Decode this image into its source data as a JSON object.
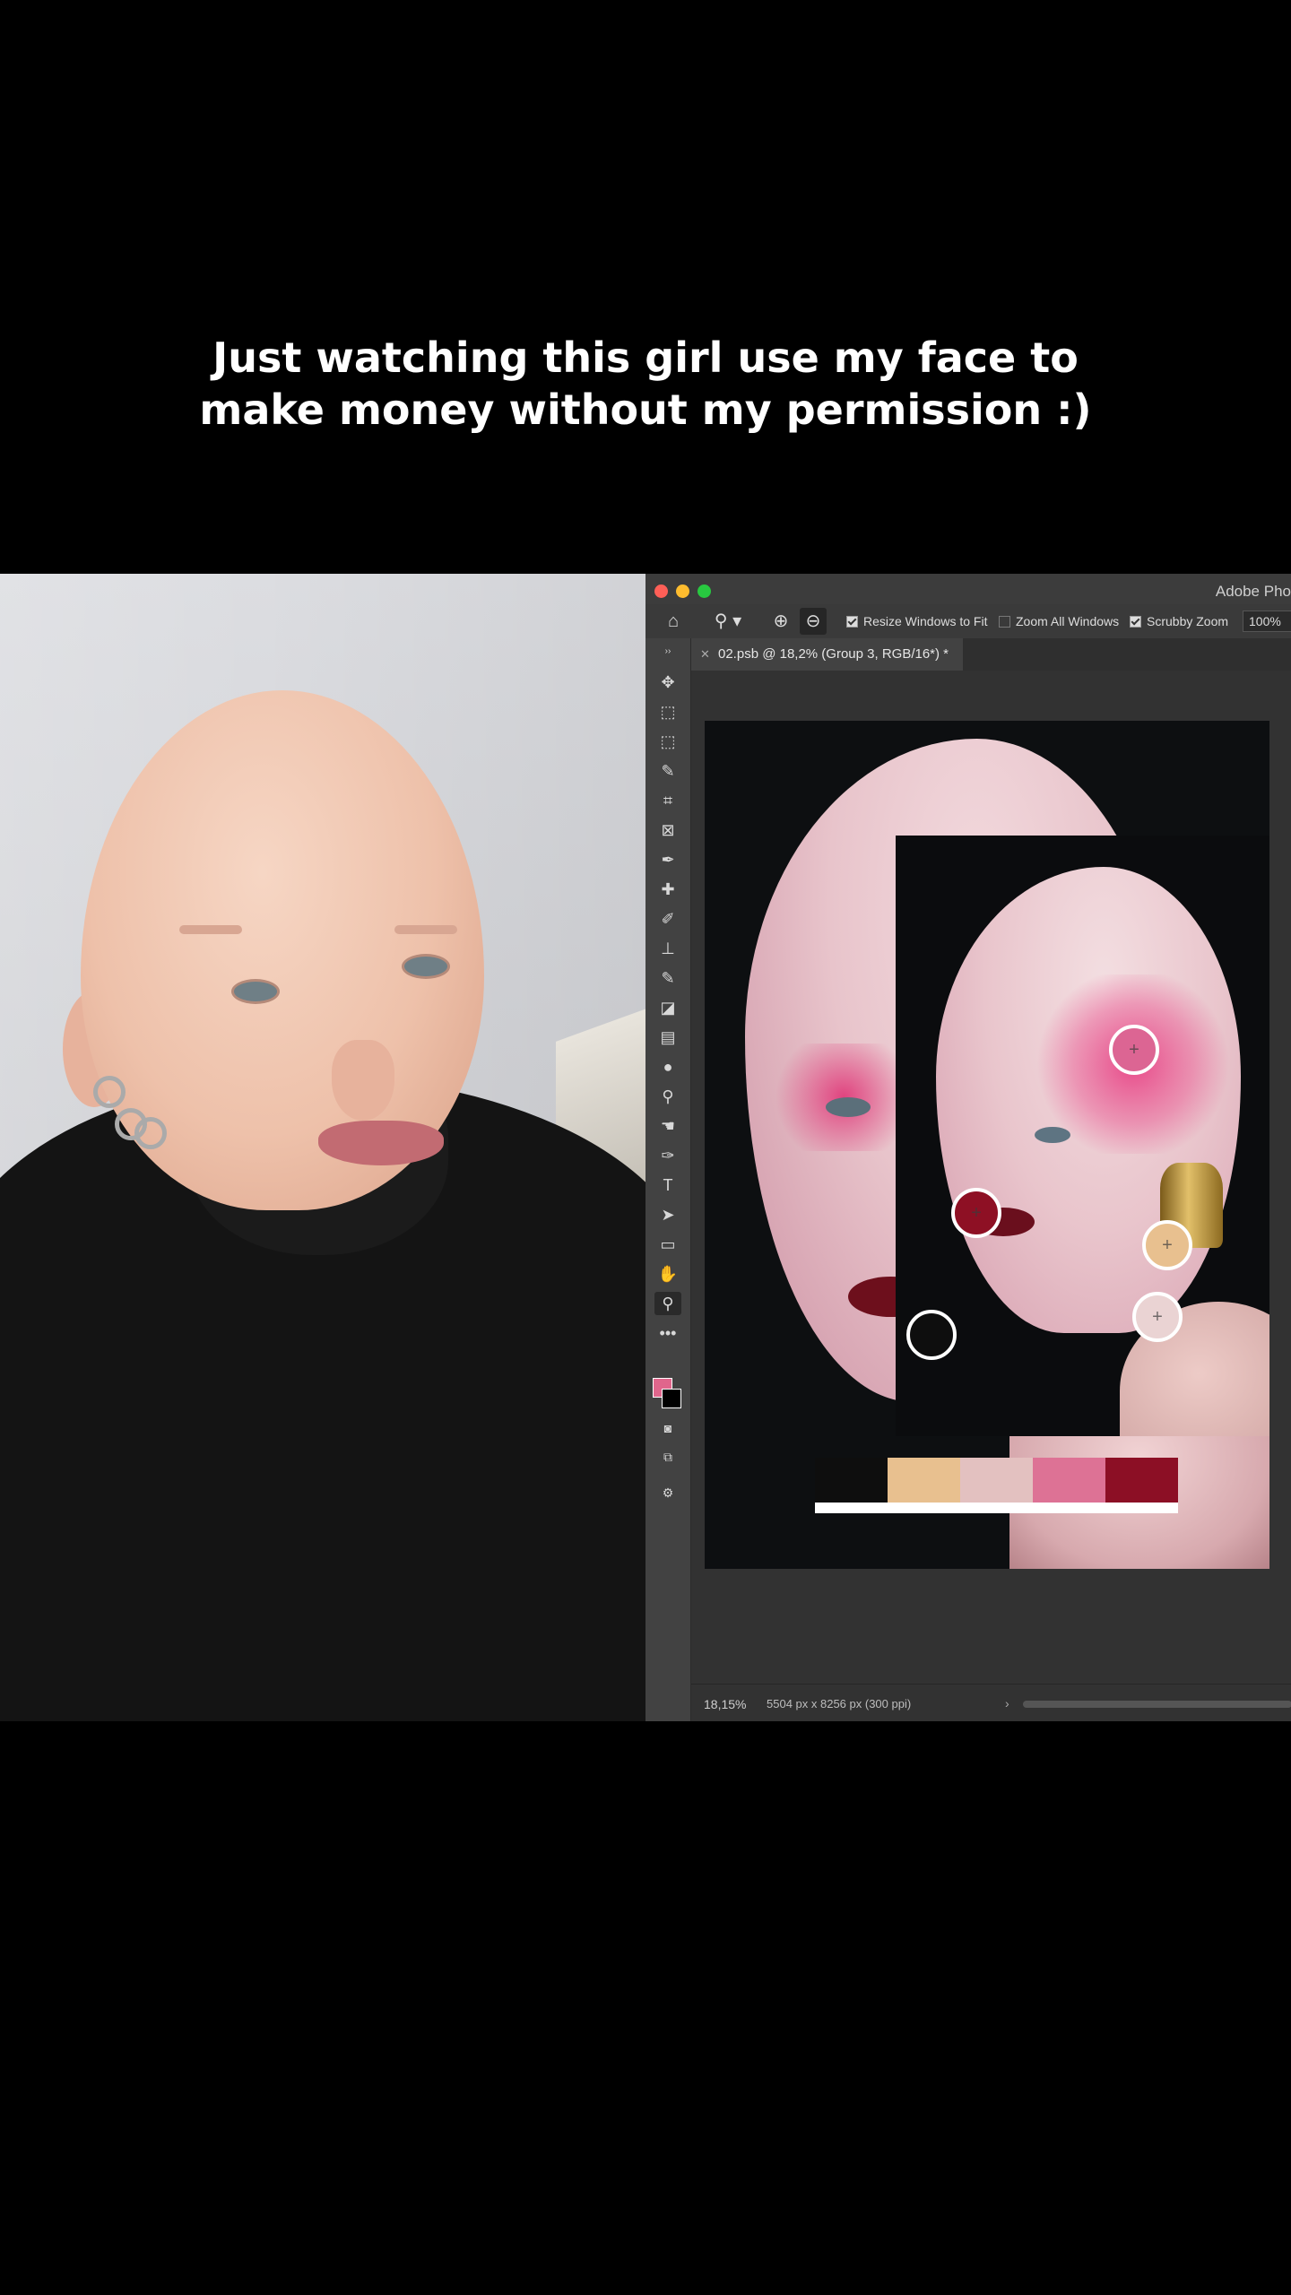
{
  "caption": {
    "line1": "Just watching this girl use my face to",
    "line2": "make money without my permission :)"
  },
  "photoshop": {
    "app_title": "Adobe Pho",
    "options": {
      "resize_windows": "Resize Windows to Fit",
      "resize_windows_checked": true,
      "zoom_all_windows": "Zoom All Windows",
      "zoom_all_windows_checked": false,
      "scrubby_zoom": "Scrubby Zoom",
      "scrubby_zoom_checked": true,
      "zoom_value": "100%"
    },
    "document_tab": "02.psb @ 18,2% (Group 3, RGB/16*) *",
    "status": {
      "zoom": "18,15%",
      "doc_size": "5504 px x 8256 px (300 ppi)"
    },
    "foreground_color": "#e0668c",
    "background_color": "#000000",
    "palette": [
      {
        "color": "#0e0e0e"
      },
      {
        "color": "#e8c08f"
      },
      {
        "color": "#e3c1c0"
      },
      {
        "color": "#dd7295"
      },
      {
        "color": "#8c0f25"
      }
    ],
    "pickers": [
      {
        "name": "picker-pink",
        "color": "#dc6593"
      },
      {
        "name": "picker-red",
        "color": "#8e1024"
      },
      {
        "name": "picker-tan",
        "color": "#e8c08f"
      },
      {
        "name": "picker-skin",
        "color": "#ead3d3"
      },
      {
        "name": "picker-black",
        "color": "#0e0e0e"
      }
    ]
  }
}
